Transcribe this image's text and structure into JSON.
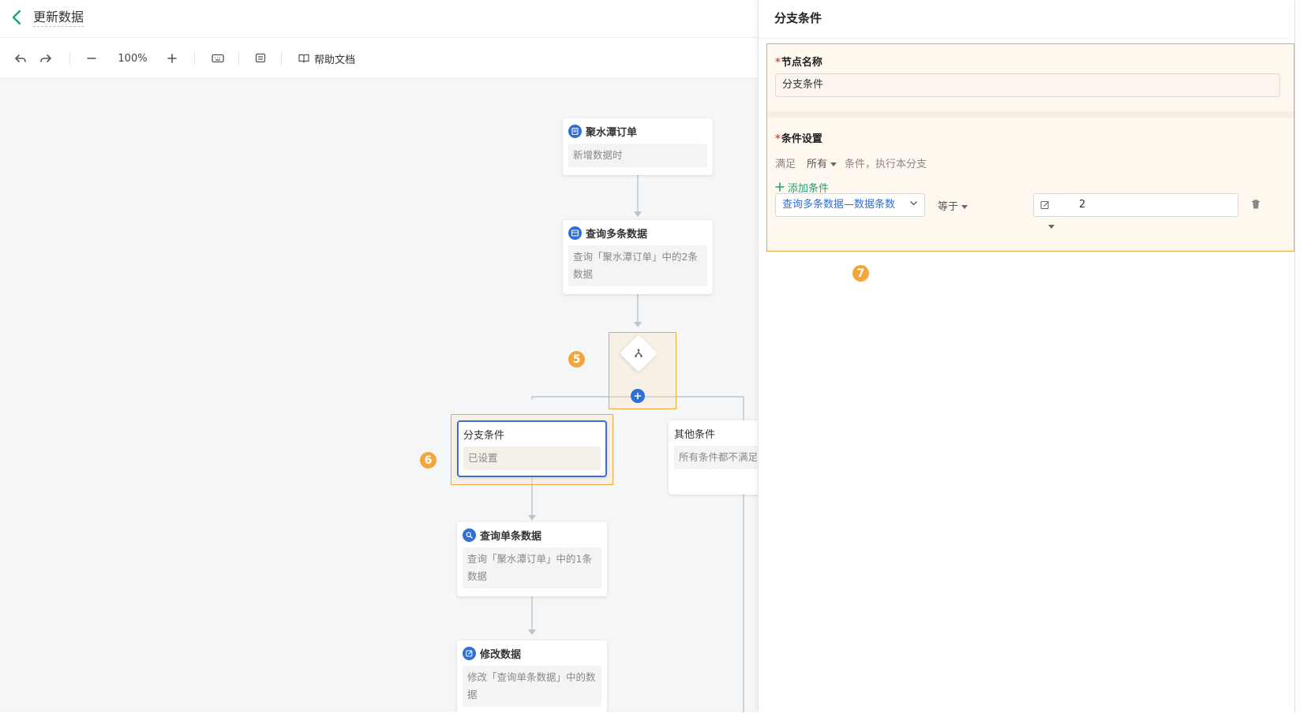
{
  "header": {
    "title": "更新数据"
  },
  "toolbar": {
    "zoom": "100%",
    "help_label": "帮助文档"
  },
  "nodes": {
    "trigger": {
      "title": "聚水潭订单",
      "desc": "新增数据时"
    },
    "query_multi": {
      "title": "查询多条数据",
      "desc": "查询「聚水潭订单」中的2条数据"
    },
    "branch_cond": {
      "title": "分支条件",
      "desc": "已设置"
    },
    "other_cond": {
      "title": "其他条件",
      "desc": "所有条件都不满足本分支"
    },
    "query_single": {
      "title": "查询单条数据",
      "desc": "查询「聚水潭订单」中的1条数据"
    },
    "modify": {
      "title": "修改数据",
      "desc": "修改「查询单条数据」中的数据"
    }
  },
  "badges": {
    "b5": "5",
    "b6": "6",
    "b7": "7"
  },
  "panel": {
    "title": "分支条件",
    "node_name_label": "节点名称",
    "node_name_value": "分支条件",
    "condition_label": "条件设置",
    "match_prefix": "满足",
    "match_mode": "所有",
    "match_suffix": "条件，执行本分支",
    "add_condition": "添加条件",
    "field_select": "查询多条数据—数据条数",
    "operator": "等于",
    "value": "2"
  },
  "colors": {
    "accent": "#1aa37a",
    "node_icon": "#2f6fd6",
    "highlight": "#f0a93b",
    "link": "#2f6fd6"
  }
}
